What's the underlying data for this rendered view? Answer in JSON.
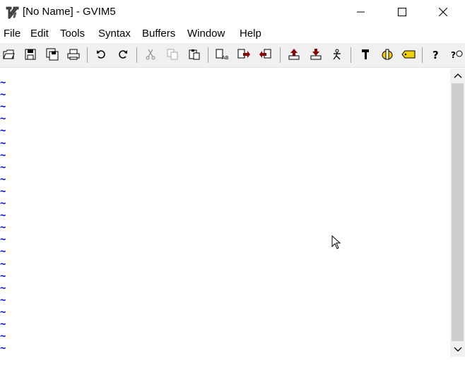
{
  "window": {
    "title": "[No Name] - GVIM5",
    "icon": "vim-app-icon",
    "controls": [
      "minimize-icon",
      "maximize-icon",
      "close-icon"
    ]
  },
  "menu": {
    "items": [
      "File",
      "Edit",
      "Tools",
      "Syntax",
      "Buffers",
      "Window",
      "Help"
    ]
  },
  "toolbar": {
    "buttons": [
      "open-icon",
      "save-icon",
      "save-all-icon",
      "print-icon",
      "undo-icon",
      "redo-icon",
      "cut-icon",
      "copy-icon",
      "paste-icon",
      "replace-icon",
      "find-next-icon",
      "find-prev-icon",
      "load-session-icon",
      "save-session-icon",
      "run-script-icon",
      "make-icon",
      "shell-icon",
      "tags-icon",
      "help-icon",
      "find-help-icon"
    ]
  },
  "editor": {
    "empty_line_marker": "~",
    "empty_line_count": 23,
    "colors": {
      "marker": "#0000ff",
      "background": "#ffffff"
    }
  }
}
